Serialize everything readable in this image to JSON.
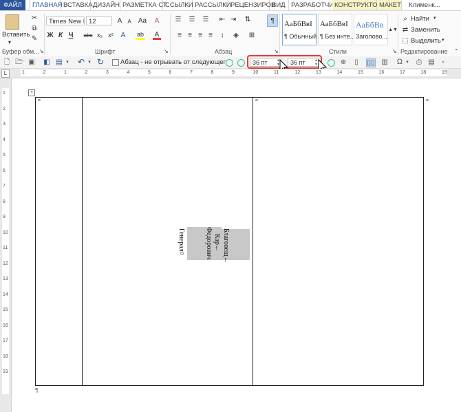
{
  "tabs": [
    {
      "label": "ФАЙЛ",
      "kind": "file"
    },
    {
      "label": "ГЛАВНАЯ",
      "kind": "active"
    },
    {
      "label": "ВСТАВКА",
      "kind": ""
    },
    {
      "label": "ДИЗАЙН",
      "kind": ""
    },
    {
      "label": "РАЗМЕТКА СТ",
      "kind": ""
    },
    {
      "label": "ССЫЛКИ",
      "kind": ""
    },
    {
      "label": "РАССЫЛКИ",
      "kind": ""
    },
    {
      "label": "РЕЦЕНЗИРОВ",
      "kind": ""
    },
    {
      "label": "ВИД",
      "kind": ""
    },
    {
      "label": "РАЗРАБОТЧИ",
      "kind": ""
    },
    {
      "label": "КОНСТРУКТОР",
      "kind": "ctx"
    },
    {
      "label": "МАКЕТ",
      "kind": "ctx"
    }
  ],
  "user": "Клименк...",
  "ribbon": {
    "clipboard": {
      "paste": "Вставить",
      "label": "Буфер обм..."
    },
    "font": {
      "name": "Times New R",
      "size": "12",
      "label": "Шрифт",
      "bold": "Ж",
      "italic": "К",
      "underline": "Ч",
      "strike": "abc",
      "sub": "x₂",
      "sup": "x²",
      "case": "Aa"
    },
    "paragraph": {
      "label": "Абзац",
      "pilcrow": "¶"
    },
    "styles": {
      "label": "Стили",
      "items": [
        {
          "sample": "АаБбВвІ",
          "name": "¶ Обычный"
        },
        {
          "sample": "АаБбВвІ",
          "name": "¶ Без инте..."
        },
        {
          "sample": "АаБбВв",
          "name": "Заголово..."
        }
      ]
    },
    "editing": {
      "label": "Редактирование",
      "find": "Найти",
      "replace": "Заменить",
      "select": "Выделить"
    }
  },
  "quickbar": {
    "keep_with_next": "Абзац - не отрывать от следующего",
    "spacing_before": "36 пт",
    "spacing_after": "36 пт"
  },
  "ruler": {
    "h_labels": [
      "1",
      "2",
      "1",
      "2",
      "3",
      "4",
      "5",
      "6",
      "7",
      "8",
      "9",
      "10",
      "11",
      "12",
      "13",
      "14",
      "15",
      "16",
      "17",
      "18",
      "19"
    ],
    "v_labels": [
      "1",
      "2",
      "3",
      "4",
      "5",
      "6",
      "7",
      "8",
      "9",
      "10",
      "11",
      "12",
      "13",
      "14",
      "15",
      "16",
      "17",
      "18",
      "19"
    ]
  },
  "document": {
    "cell_mark": "¤",
    "para_mark": "¶",
    "text_general": "Генерал¤",
    "text_fedorovich": "Федорович",
    "text_kar": "Кар←",
    "text_blagovesh": "Благовещ←"
  },
  "colors": {
    "file_tab": "#2b579a",
    "accent": "#2b579a",
    "context_tab": "#f7f3c6",
    "highlight_red": "#e53935"
  }
}
